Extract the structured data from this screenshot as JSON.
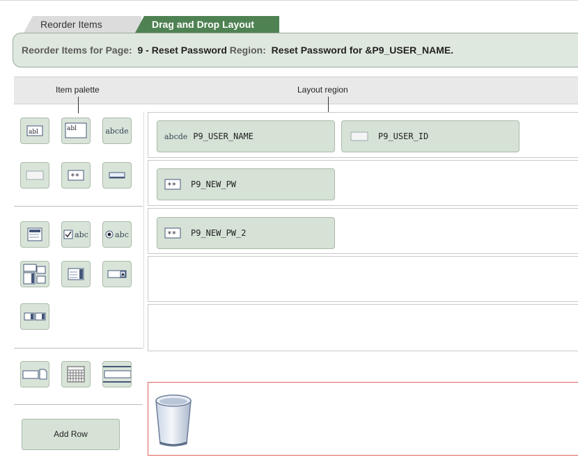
{
  "tabs": [
    {
      "label": "Reorder Items",
      "active": false
    },
    {
      "label": "Drag and Drop Layout",
      "active": true
    }
  ],
  "info": {
    "page_label": "Reorder Items for Page:",
    "page_value": "9 - Reset Password",
    "region_label": "Region:",
    "region_value": "Reset Password for &P9_USER_NAME."
  },
  "headers": {
    "palette": "Item palette",
    "layout": "Layout region"
  },
  "palette": {
    "icons": [
      "text-field-icon",
      "text-field-editable-icon",
      "display-text-icon",
      "hidden-item-icon",
      "password-icon",
      "button-icon",
      "textarea-icon",
      "checkbox-icon",
      "radio-icon",
      "shuttle-icon",
      "select-list-icon",
      "popup-lov-icon",
      "multi-select-icon",
      "file-browse-icon",
      "date-picker-icon",
      "stop-start-icon"
    ],
    "checkbox_text": "abc",
    "radio_text": "abc",
    "abl": "abl",
    "abcde": "abcde",
    "add_row_label": "Add Row"
  },
  "layout": {
    "rows": [
      {
        "items": [
          {
            "label": "P9_USER_NAME",
            "icon": "display-text-icon",
            "icon_text": "abcde"
          },
          {
            "label": "P9_USER_ID",
            "icon": "hidden-item-icon"
          }
        ]
      },
      {
        "items": [
          {
            "label": "P9_NEW_PW",
            "icon": "password-icon"
          }
        ]
      },
      {
        "items": [
          {
            "label": "P9_NEW_PW_2",
            "icon": "password-icon"
          }
        ]
      },
      {
        "items": []
      },
      {
        "items": []
      }
    ]
  },
  "colors": {
    "accent": "#4f8253",
    "item_bg": "#d6e2d6",
    "trash_border": "#e06060"
  }
}
